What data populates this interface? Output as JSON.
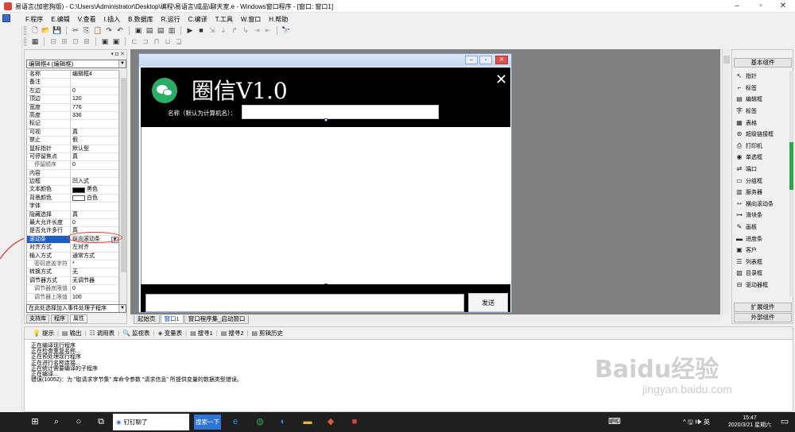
{
  "window": {
    "title": "易语言(加密狗版) - C:\\Users\\Administrator\\Desktop\\编程\\易语言\\成品\\聊天室.e - Windows窗口程序 - [窗口: 窗口1]",
    "buttons": {
      "minimize": "–",
      "maximize": "▫",
      "close": "✕"
    }
  },
  "menubar": [
    "F.程序",
    "E.编辑",
    "V.查看",
    "I.插入",
    "B.数据库",
    "R.运行",
    "C.编译",
    "T.工具",
    "W.窗口",
    "H.帮助"
  ],
  "toolbar1": [
    "new-file-icon",
    "open-folder-icon",
    "save-icon",
    "cut-icon",
    "copy-icon",
    "paste-icon",
    "redo-icon",
    "undo-icon",
    "view-icon",
    "layout1-icon",
    "layout2-icon",
    "layout3-icon",
    "run-icon",
    "stop-icon",
    "step1-icon",
    "step2-icon",
    "step3-icon",
    "step4-icon",
    "step5-icon",
    "step6-icon",
    "binoculars-icon"
  ],
  "toolbar1_glyphs": [
    "🗋",
    "📂",
    "💾",
    "✂",
    "⎘",
    "📋",
    "↷",
    "↶",
    "▣",
    "▤",
    "▤",
    "▥",
    "▶",
    "■",
    "⇲",
    "⇣",
    "↱",
    "↳",
    "⇥",
    "⇤",
    "🔭"
  ],
  "toolbar2_glyphs": [
    "▦",
    "⊟",
    "⊞",
    "⊡",
    "⊠",
    "▣",
    "▣",
    "⊏",
    "⊐",
    "⊓",
    "⊔",
    "⊒"
  ],
  "property_panel": {
    "panel_icons": "▾ ◘ ✕",
    "object_combo": "编辑框4 (编辑框)",
    "rows": [
      {
        "name": "名称",
        "value": "编辑框4",
        "sub": false
      },
      {
        "name": "备注",
        "value": "",
        "sub": false
      },
      {
        "name": "左边",
        "value": "0",
        "sub": false
      },
      {
        "name": "顶边",
        "value": "120",
        "sub": false
      },
      {
        "name": "宽度",
        "value": "776",
        "sub": false
      },
      {
        "name": "高度",
        "value": "336",
        "sub": false
      },
      {
        "name": "标记",
        "value": "",
        "sub": false
      },
      {
        "name": "可视",
        "value": "真",
        "sub": false
      },
      {
        "name": "禁止",
        "value": "假",
        "sub": false
      },
      {
        "name": "鼠标指针",
        "value": "默认型",
        "sub": false
      },
      {
        "name": "可停留焦点",
        "value": "真",
        "sub": false
      },
      {
        "name": "停留顺序",
        "value": "0",
        "sub": true
      },
      {
        "name": "内容",
        "value": "",
        "sub": false
      },
      {
        "name": "边框",
        "value": "凹入式",
        "sub": false
      },
      {
        "name": "文本颜色",
        "value": "黑色",
        "sub": false,
        "swatch": "#000000"
      },
      {
        "name": "背景颜色",
        "value": "白色",
        "sub": false,
        "swatch": "#ffffff"
      },
      {
        "name": "字体",
        "value": "",
        "sub": false
      },
      {
        "name": "隐藏选择",
        "value": "真",
        "sub": false
      },
      {
        "name": "最大允许长度",
        "value": "0",
        "sub": false
      },
      {
        "name": "是否允许多行",
        "value": "真",
        "sub": false
      },
      {
        "name": "滚动条",
        "value": "纵向滚动条",
        "sub": false,
        "selected": true
      },
      {
        "name": "对齐方式",
        "value": "左对齐",
        "sub": false
      },
      {
        "name": "输入方式",
        "value": "通常方式",
        "sub": false
      },
      {
        "name": "密码遮盖字符",
        "value": "*",
        "sub": true
      },
      {
        "name": "转换方式",
        "value": "无",
        "sub": false
      },
      {
        "name": "调节器方式",
        "value": "无调节器",
        "sub": false
      },
      {
        "name": "调节器底限值",
        "value": "0",
        "sub": true
      },
      {
        "name": "调节器上限值",
        "value": "100",
        "sub": true
      }
    ],
    "event_combo": "在此处选择加入事件处理子程序",
    "tabs": [
      "支持库",
      "程序",
      "属性"
    ]
  },
  "form": {
    "title": "圈信V1.0",
    "close_glyph": "✕",
    "name_label": "名称（默认为计算机名）：",
    "send_button": "发送"
  },
  "design_tabs": [
    "起始页",
    "窗口1",
    "窗口程序集_启动窗口"
  ],
  "component_panel": {
    "header_basic": "基本组件",
    "header_ext": "扩展组件",
    "header_external": "外部组件",
    "items": [
      {
        "label": "指针",
        "icon": "↖"
      },
      {
        "label": "标签",
        "icon": "⌐"
      },
      {
        "label": "编辑框",
        "icon": "▤"
      },
      {
        "label": "标签",
        "icon": "字"
      },
      {
        "label": "表格",
        "icon": "▦"
      },
      {
        "label": "超级链接框",
        "icon": "⊛"
      },
      {
        "label": "打印机",
        "icon": "⎙"
      },
      {
        "label": "单选框",
        "icon": "◉"
      },
      {
        "label": "端口",
        "icon": "⇄"
      },
      {
        "label": "分组框",
        "icon": "▭"
      },
      {
        "label": "服务器",
        "icon": "▥"
      },
      {
        "label": "横向滚动条",
        "icon": "⇿"
      },
      {
        "label": "滑块条",
        "icon": "⊶"
      },
      {
        "label": "画板",
        "icon": "✎"
      },
      {
        "label": "进度条",
        "icon": "▬"
      },
      {
        "label": "客户",
        "icon": "▣"
      },
      {
        "label": "列表框",
        "icon": "☰"
      },
      {
        "label": "目录框",
        "icon": "▨"
      },
      {
        "label": "驱动器框",
        "icon": "⊟"
      }
    ]
  },
  "output_panel": {
    "tabs": [
      {
        "label": "提示",
        "icon": "💡"
      },
      {
        "label": "输出",
        "icon": "▤"
      },
      {
        "label": "调用表",
        "icon": "☷"
      },
      {
        "label": "监视表",
        "icon": "🔍"
      },
      {
        "label": "变量表",
        "icon": "◈"
      },
      {
        "label": "搜寻1",
        "icon": "▤"
      },
      {
        "label": "搜寻2",
        "icon": "▤"
      },
      {
        "label": "剪辑历史",
        "icon": "▤"
      }
    ],
    "lines": [
      "正在编译现行程序",
      "正在检查重复名称...",
      "正在预处理现行程序",
      "正在进行名称连接...",
      "正在统计需要编译的子程序",
      "正在编译...",
      "错误(10052)：为 \"取请求字节集\" 库命令参数 \"请求信息\" 所提供变量的数据类型错误。"
    ]
  },
  "watermark": {
    "logo": "Baidu经验",
    "url": "jingyan.baidu.com"
  },
  "taskbar": {
    "task_label": "钉钉聊了",
    "search_label": "搜索一下",
    "time": "15:47",
    "date": "2020/3/21 星期六",
    "tray": "^ 🖫 🕪 英"
  }
}
